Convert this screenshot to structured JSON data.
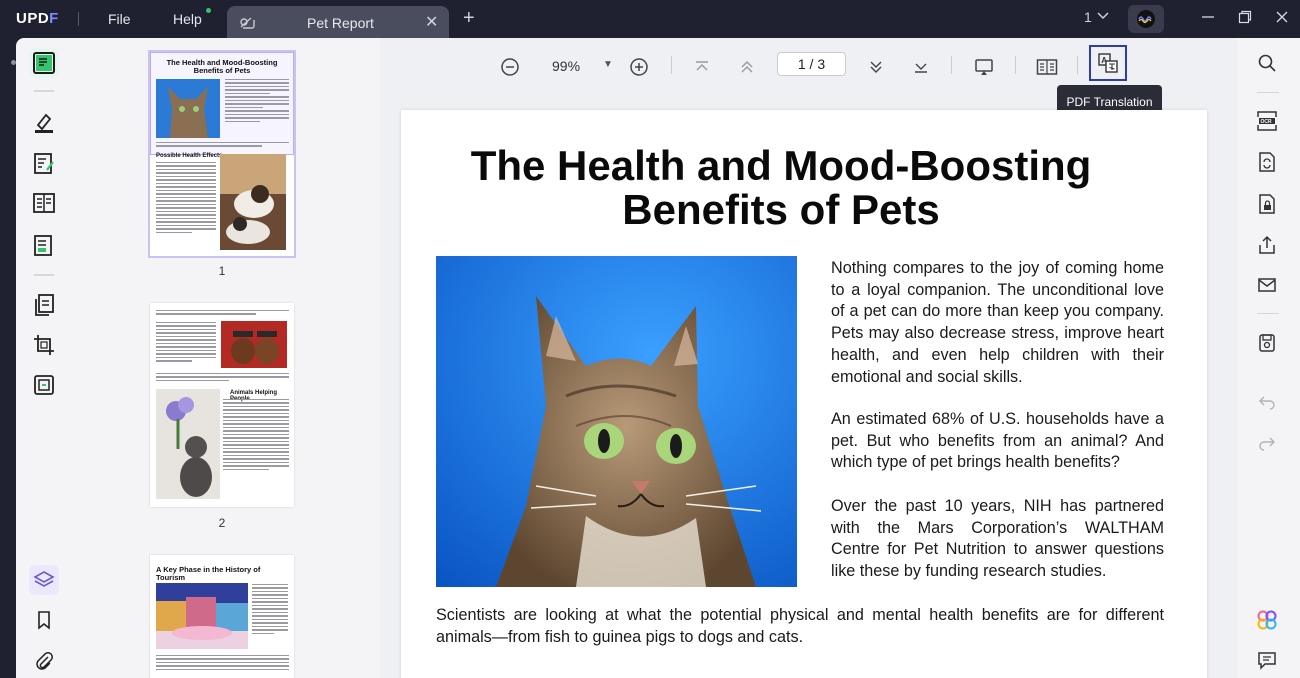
{
  "app": {
    "logo_a": "UPD",
    "logo_b": "F"
  },
  "menu": {
    "file": "File",
    "help": "Help"
  },
  "tab": {
    "title": "Pet Report",
    "close": "✕"
  },
  "window": {
    "page_indicator": "1"
  },
  "thumbnails": [
    {
      "number": "1",
      "title": "The Health and Mood-Boosting Benefits of Pets",
      "heading": "Possible Health Effects"
    },
    {
      "number": "2",
      "heading": "Animals Helping People"
    },
    {
      "title": "A Key Phase in the History of Tourism"
    }
  ],
  "toolbar": {
    "zoom": "99%",
    "page_current": "1",
    "page_total": "3",
    "page_sep": "/",
    "tooltip": "PDF Translation"
  },
  "document": {
    "title_line1": "The Health and Mood-Boosting",
    "title_line2": "Benefits of Pets",
    "paragraphs": [
      "Nothing compares to the joy of coming home to a loyal companion. The unconditional love of a pet can do more than keep you company. Pets may also decrease stress, improve heart health, and even help children with their emotional and social skills.",
      "An estimated 68% of U.S. households have a pet. But who benefits from an animal? And which type of pet brings health benefits?",
      "Over the past 10 years, NIH has partnered with the Mars Corporation’s WALTHAM Centre for Pet Nutrition to answer questions like these by funding research studies."
    ],
    "paragraph_full": "Scientists are looking at what the potential physical and mental health benefits are for different animals—from fish to guinea pigs to dogs and cats."
  },
  "colors": {
    "accent": "#2f3da8",
    "rail_active": "#35c46b",
    "titlebar": "#1f2030"
  }
}
